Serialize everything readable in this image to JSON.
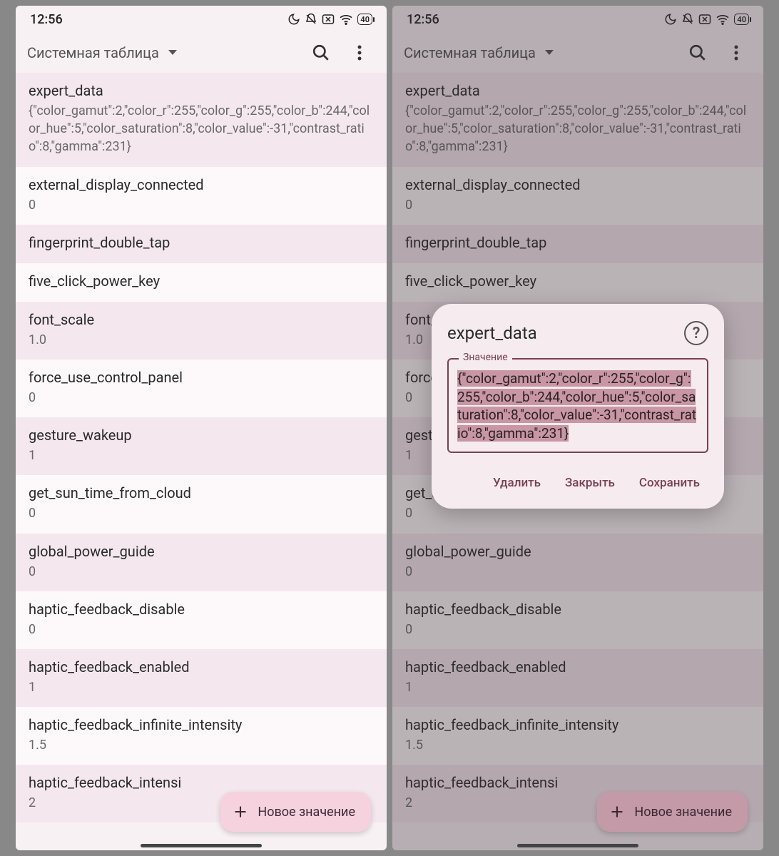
{
  "status": {
    "time": "12:56",
    "battery": "40"
  },
  "toolbar": {
    "dropdown_label": "Системная таблица"
  },
  "fab": {
    "label": "Новое значение"
  },
  "rows": [
    {
      "key": "expert_data",
      "val": "{\"color_gamut\":2,\"color_r\":255,\"color_g\":255,\"color_b\":244,\"color_hue\":5,\"color_saturation\":8,\"color_value\":-31,\"contrast_ratio\":8,\"gamma\":231}"
    },
    {
      "key": "external_display_connected",
      "val": "0"
    },
    {
      "key": "fingerprint_double_tap",
      "val": ""
    },
    {
      "key": "five_click_power_key",
      "val": ""
    },
    {
      "key": "font_scale",
      "val": "1.0"
    },
    {
      "key": "force_use_control_panel",
      "val": "0"
    },
    {
      "key": "gesture_wakeup",
      "val": "1"
    },
    {
      "key": "get_sun_time_from_cloud",
      "val": "0"
    },
    {
      "key": "global_power_guide",
      "val": "0"
    },
    {
      "key": "haptic_feedback_disable",
      "val": "0"
    },
    {
      "key": "haptic_feedback_enabled",
      "val": "1"
    },
    {
      "key": "haptic_feedback_infinite_intensity",
      "val": "1.5"
    },
    {
      "key": "haptic_feedback_intensi",
      "val": "2"
    }
  ],
  "dialog": {
    "title": "expert_data",
    "field_label": "Значение",
    "field_value": "{\"color_gamut\":2,\"color_r\":255,\"color_g\":255,\"color_b\":244,\"color_hue\":5,\"color_saturation\":8,\"color_value\":-31,\"contrast_ratio\":8,\"gamma\":231}",
    "delete": "Удалить",
    "close": "Закрыть",
    "save": "Сохранить"
  },
  "row_trunc_prefixes": [
    "five",
    "fo",
    "fo",
    "ge",
    "ge",
    "g"
  ]
}
